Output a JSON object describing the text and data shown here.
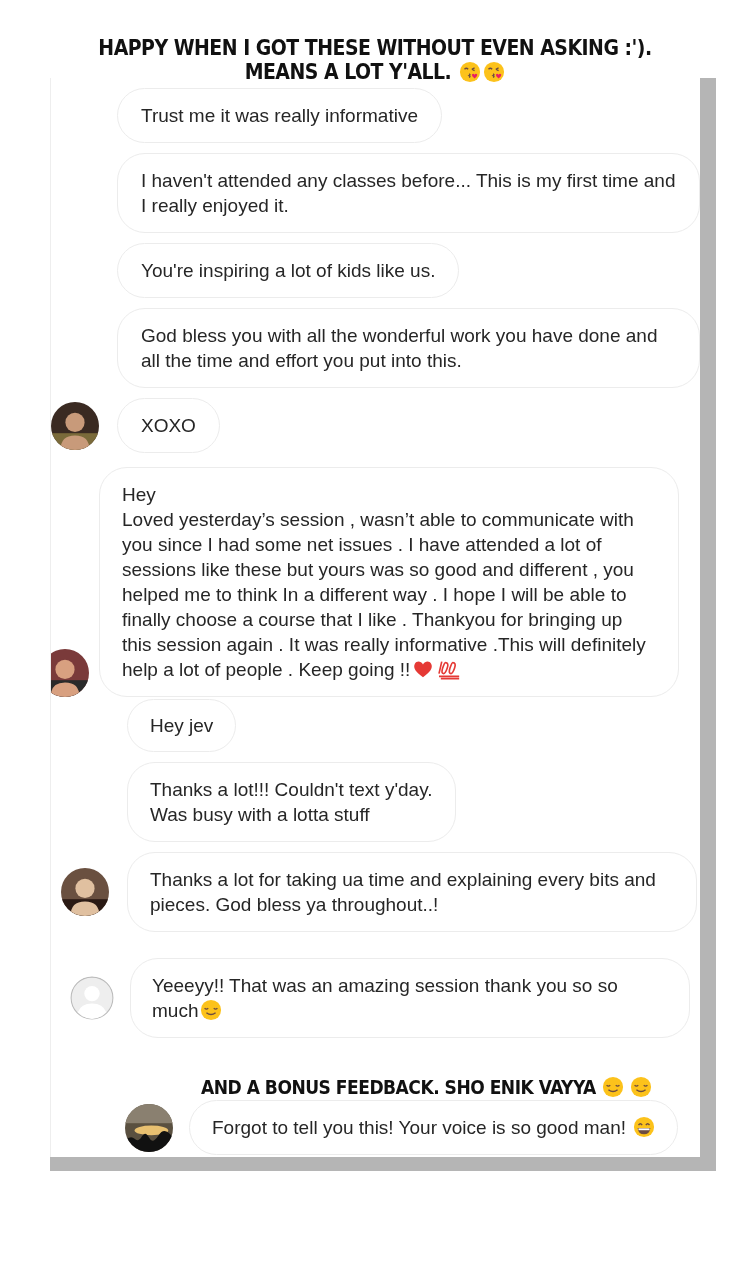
{
  "heading": {
    "text": "HAPPY WHEN I GOT THESE WITHOUT EVEN ASKING :').  MEANS A LOT Y'ALL.",
    "emojis": [
      {
        "kind": "kiss"
      },
      {
        "kind": "kiss"
      }
    ]
  },
  "messages": [
    {
      "text": "Trust me it was really informative",
      "kind": "plain"
    },
    {
      "text": "I haven't attended any classes before... This is my first time and I really enjoyed it.",
      "kind": "plain"
    },
    {
      "text": "You're inspiring a lot of kids like us.",
      "kind": "plain"
    },
    {
      "text": "God bless you with all the wonderful work you have done and all the time and effort you put into this.",
      "kind": "plain"
    },
    {
      "text": "XOXO"
    },
    {
      "text": "Hey\nLoved yesterday’s session , wasn’t able to communicate with you since I had some net issues . I have attended a lot of sessions like these but yours was so good and different  , you helped me to think In a different way . I hope I will be able to finally choose a course that I like . Thankyou for bringing up this session again . It was really informative .This will definitely help a lot of people . Keep going !!",
      "emojis": [
        {
          "kind": "heart"
        },
        {
          "kind": "hundred"
        }
      ]
    },
    {
      "text": "Hey jev",
      "kind": "plain"
    },
    {
      "text": "Thanks a lot!!! Couldn't text y'day.\nWas busy with a lotta stuff",
      "kind": "plain"
    },
    {
      "text": "Thanks a lot for taking ua time and explaining every bits and pieces. God bless ya throughout..!"
    },
    {
      "text": "Yeeeyy!! That was an amazing session thank you so so much",
      "kind": "default",
      "emojis": [
        {
          "kind": "relieved"
        }
      ]
    }
  ],
  "bonus": {
    "heading": "AND A BONUS FEEDBACK. SHO ENIK VAYYA",
    "emojis": [
      {
        "kind": "relieved"
      },
      {
        "kind": "relieved"
      }
    ],
    "message": {
      "text": "Forgot to tell you this! Your voice is so good man!",
      "emojis": [
        {
          "kind": "grin"
        }
      ]
    }
  }
}
